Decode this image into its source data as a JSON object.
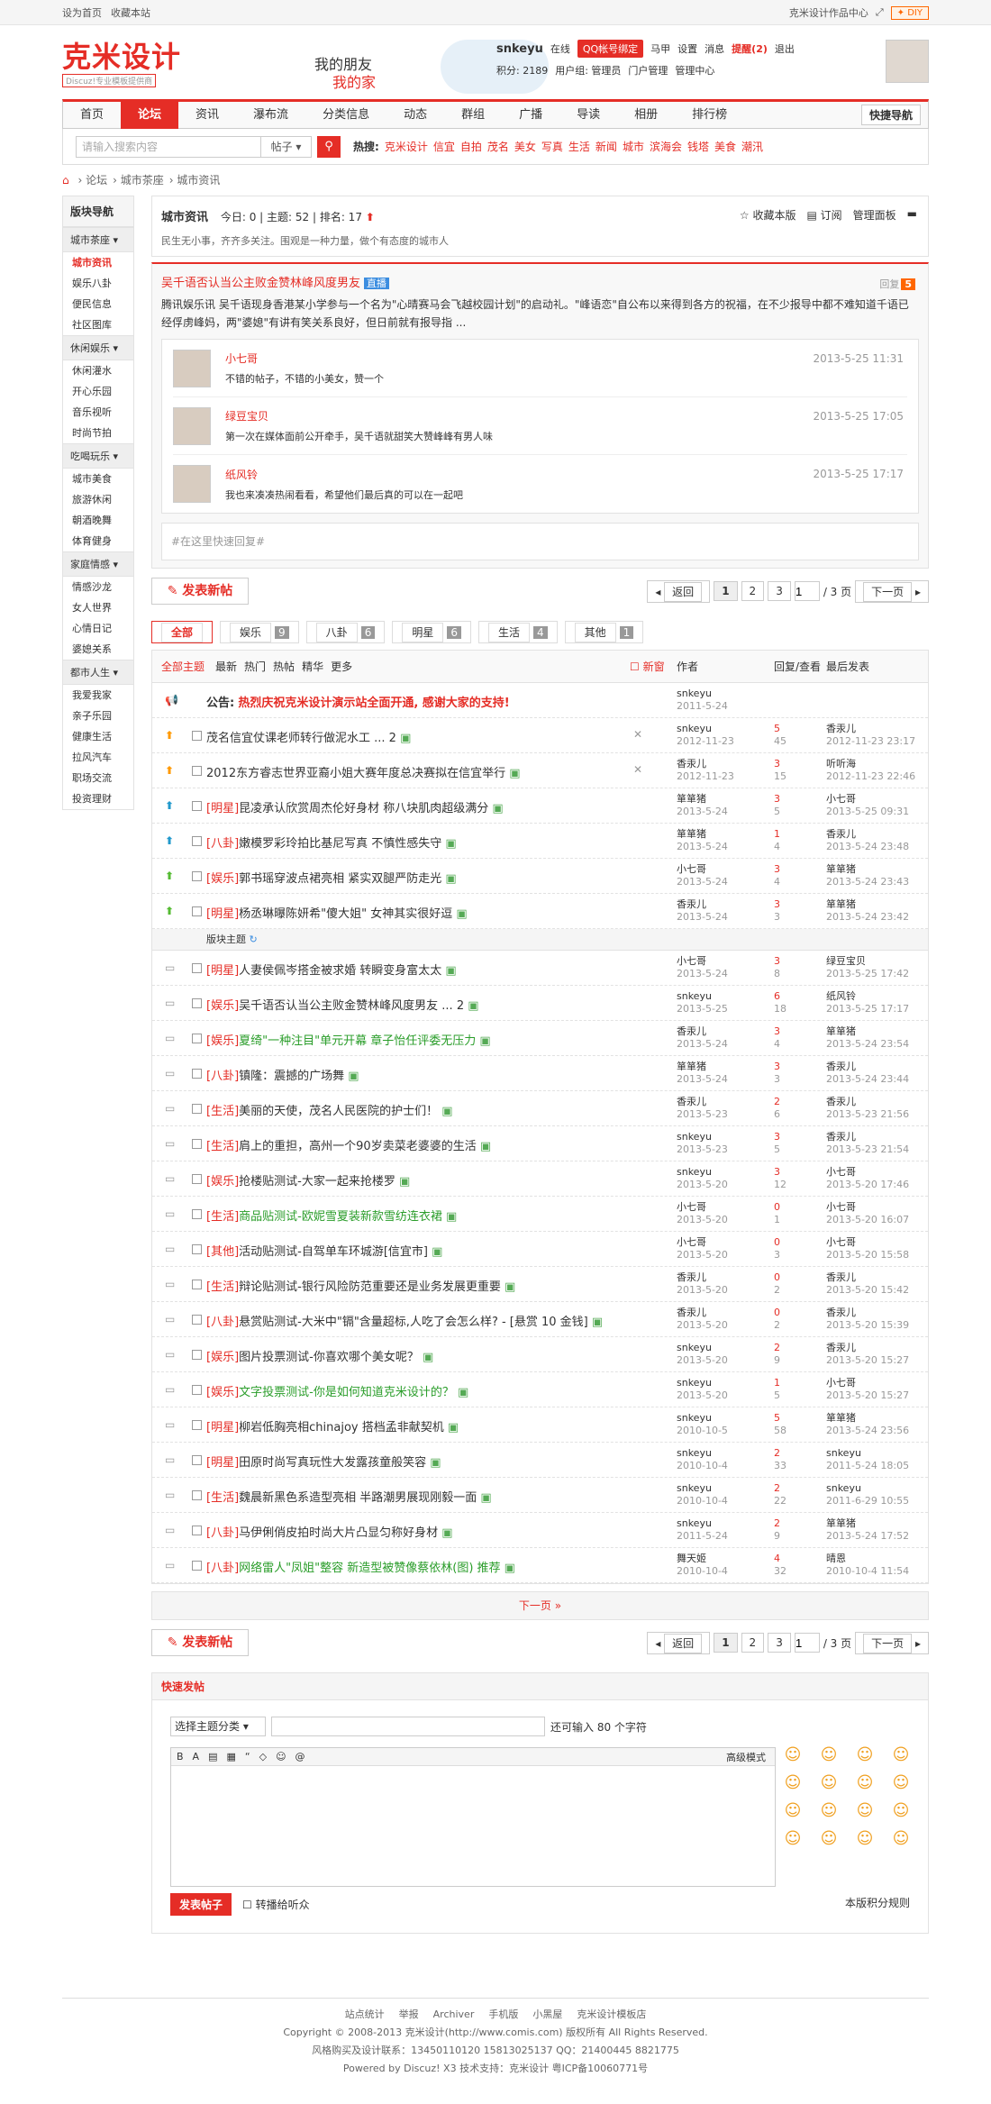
{
  "topbar": {
    "home": "设为首页",
    "fav": "收藏本站",
    "works": "克米设计作品中心",
    "diy": "DIY"
  },
  "logo": {
    "main": "克米设计",
    "sub": "Discuz!专业模板提供商"
  },
  "banner": {
    "line1": "我的朋友",
    "line2": "我的家"
  },
  "user": {
    "name": "snkeyu",
    "online": "在线",
    "qq": "QQ帐号绑定",
    "horse": "马甲",
    "settings": "设置",
    "msg": "消息",
    "alert": "提醒(2)",
    "logout": "退出",
    "points": "积分: 2189",
    "group": "用户组: 管理员",
    "portal": "门户管理",
    "admin": "管理中心"
  },
  "nav": {
    "items": [
      "首页",
      "论坛",
      "资讯",
      "瀑布流",
      "分类信息",
      "动态",
      "群组",
      "广播",
      "导读",
      "相册",
      "排行榜"
    ],
    "quick": "快捷导航"
  },
  "search": {
    "placeholder": "请输入搜索内容",
    "type": "帖子",
    "hot_label": "热搜:",
    "hot": [
      "克米设计",
      "信宜",
      "自拍",
      "茂名",
      "美女",
      "写真",
      "生活",
      "新闻",
      "城市",
      "滨海会",
      "钱塔",
      "美食",
      "潮汛"
    ]
  },
  "crumb": [
    "论坛",
    "城市茶座",
    "城市资讯"
  ],
  "side": {
    "title": "版块导航",
    "groups": [
      {
        "name": "城市茶座",
        "items": [
          "城市资讯",
          "娱乐八卦",
          "便民信息",
          "社区图库"
        ]
      },
      {
        "name": "休闲娱乐",
        "items": [
          "休闲灌水",
          "开心乐园",
          "音乐视听",
          "时尚节拍"
        ]
      },
      {
        "name": "吃喝玩乐",
        "items": [
          "城市美食",
          "旅游休闲",
          "朝酒晚舞",
          "体育健身"
        ]
      },
      {
        "name": "家庭情感",
        "items": [
          "情感沙龙",
          "女人世界",
          "心情日记",
          "婆媳关系"
        ]
      },
      {
        "name": "都市人生",
        "items": [
          "我爱我家",
          "亲子乐园",
          "健康生活",
          "拉风汽车",
          "职场交流",
          "投资理财"
        ]
      }
    ]
  },
  "forum": {
    "title": "城市资讯",
    "today": "今日: 0",
    "threads": "主题: 52",
    "rank": "排名: 17",
    "desc": "民生无小事，齐齐多关注。围观是一种力量，做个有态度的城市人",
    "fav": "收藏本版",
    "rss": "订阅",
    "manage": "管理面板"
  },
  "featured": {
    "title": "吴千语否认当公主败金赞林峰风度男友",
    "badge": "直播",
    "reply": "回复",
    "count": "5",
    "summary": "腾讯娱乐讯 吴千语现身香港某小学参与一个名为\"心晴赛马会飞越校园计划\"的启动礼。\"峰语恋\"自公布以来得到各方的祝福，在不少报导中都不难知道千语已经俘虏峰妈，两\"婆媳\"有讲有笑关系良好，但日前就有报导指 ...",
    "replies": [
      {
        "user": "小七哥",
        "msg": "不错的帖子，不错的小美女，赞一个",
        "date": "2013-5-25 11:31"
      },
      {
        "user": "绿豆宝贝",
        "msg": "第一次在媒体面前公开牵手，吴千语就甜笑大赞峰峰有男人味",
        "date": "2013-5-25 17:05"
      },
      {
        "user": "纸风铃",
        "msg": "我也来凑凑热闹看看，希望他们最后真的可以在一起吧",
        "date": "2013-5-25 17:17"
      }
    ],
    "quick": "#在这里快速回复#"
  },
  "pager": {
    "newpost": "发表新帖",
    "back": "返回",
    "pages": [
      "1",
      "2",
      "3"
    ],
    "total": "/ 3 页",
    "next": "下一页"
  },
  "tabs": [
    {
      "label": "全部",
      "n": ""
    },
    {
      "label": "娱乐",
      "n": "9"
    },
    {
      "label": "八卦",
      "n": "6"
    },
    {
      "label": "明星",
      "n": "6"
    },
    {
      "label": "生活",
      "n": "4"
    },
    {
      "label": "其他",
      "n": "1"
    }
  ],
  "thead": {
    "all": "全部主题",
    "newest": "最新",
    "hot": "热门",
    "heat": "热帖",
    "digest": "精华",
    "more": "更多",
    "new": "新窗",
    "author": "作者",
    "rv": "回复/查看",
    "last": "最后发表"
  },
  "announce": {
    "label": "公告:",
    "title": "热烈庆祝克米设计演示站全面开通, 感谢大家的支持!",
    "author": "snkeyu",
    "date": "2011-5-24"
  },
  "sticky": [
    {
      "cat": "",
      "title": "茂名信宜仗课老师转行做泥水工",
      "extra": "... 2",
      "au": "snkeyu",
      "ad": "2012-11-23",
      "r": "5",
      "v": "45",
      "lu": "香汞儿",
      "ld": "2012-11-23 23:17"
    },
    {
      "cat": "",
      "title": "2012东方睿志世界亚裔小姐大赛年度总决赛拟在信宜举行",
      "extra": "",
      "au": "香汞儿",
      "ad": "2012-11-23",
      "r": "3",
      "v": "15",
      "lu": "听听海",
      "ld": "2012-11-23 22:46"
    },
    {
      "cat": "[明星]",
      "title": "昆凌承认欣赏周杰伦好身材 称八块肌肉超级满分",
      "extra": "",
      "au": "箪箪猪",
      "ad": "2013-5-24",
      "r": "3",
      "v": "5",
      "lu": "小七哥",
      "ld": "2013-5-25 09:31"
    },
    {
      "cat": "[八卦]",
      "title": "嫩模罗彩玲拍比基尼写真 不慎性感失守",
      "extra": "",
      "au": "箪箪猪",
      "ad": "2013-5-24",
      "r": "1",
      "v": "4",
      "lu": "香汞儿",
      "ld": "2013-5-24 23:48"
    },
    {
      "cat": "[娱乐]",
      "title": "郭书瑶穿波点裙亮相 紧实双腿严防走光",
      "extra": "",
      "au": "小七哥",
      "ad": "2013-5-24",
      "r": "3",
      "v": "4",
      "lu": "箪箪猪",
      "ld": "2013-5-24 23:43"
    },
    {
      "cat": "[明星]",
      "title": "杨丞琳曝陈妍希\"傻大姐\" 女神其实很好逗",
      "extra": "",
      "au": "香汞儿",
      "ad": "2013-5-24",
      "r": "3",
      "v": "3",
      "lu": "箪箪猪",
      "ld": "2013-5-24 23:42"
    }
  ],
  "sep": "版块主题",
  "normal": [
    {
      "cat": "[明星]",
      "title": "人妻侯佩岑搭金被求婚 转瞬变身富太太",
      "au": "小七哥",
      "ad": "2013-5-24",
      "r": "3",
      "v": "8",
      "lu": "绿豆宝贝",
      "ld": "2013-5-25 17:42"
    },
    {
      "cat": "[娱乐]",
      "title": "吴千语否认当公主败金赞林峰风度男友 ... 2",
      "au": "snkeyu",
      "ad": "2013-5-25",
      "r": "6",
      "v": "18",
      "lu": "纸风铃",
      "ld": "2013-5-25 17:17"
    },
    {
      "cat": "[娱乐]",
      "title": "夏绮\"一种注目\"单元开幕 章子怡任评委无压力",
      "au": "香汞儿",
      "ad": "2013-5-24",
      "r": "3",
      "v": "4",
      "lu": "箪箪猪",
      "ld": "2013-5-24 23:54"
    },
    {
      "cat": "[八卦]",
      "title": "镇隆：震撼的广场舞",
      "au": "箪箪猪",
      "ad": "2013-5-24",
      "r": "3",
      "v": "3",
      "lu": "香汞儿",
      "ld": "2013-5-24 23:44"
    },
    {
      "cat": "[生活]",
      "title": "美丽的天使，茂名人民医院的护士们！",
      "au": "香汞儿",
      "ad": "2013-5-23",
      "r": "2",
      "v": "6",
      "lu": "香汞儿",
      "ld": "2013-5-23 21:56"
    },
    {
      "cat": "[生活]",
      "title": "肩上的重担，高州一个90岁卖菜老婆婆的生活",
      "au": "snkeyu",
      "ad": "2013-5-23",
      "r": "3",
      "v": "5",
      "lu": "香汞儿",
      "ld": "2013-5-23 21:54"
    },
    {
      "cat": "[娱乐]",
      "title": "抢楼贴测试-大家一起来抢楼罗",
      "au": "snkeyu",
      "ad": "2013-5-20",
      "r": "3",
      "v": "12",
      "lu": "小七哥",
      "ld": "2013-5-20 17:46"
    },
    {
      "cat": "[生活]",
      "title": "商品贴测试-欧妮雪夏装新款雪纺连衣裙",
      "au": "小七哥",
      "ad": "2013-5-20",
      "r": "0",
      "v": "1",
      "lu": "小七哥",
      "ld": "2013-5-20 16:07"
    },
    {
      "cat": "[其他]",
      "title": "活动贴测试-自驾单车环城游[信宜市]",
      "au": "小七哥",
      "ad": "2013-5-20",
      "r": "0",
      "v": "3",
      "lu": "小七哥",
      "ld": "2013-5-20 15:58"
    },
    {
      "cat": "[生活]",
      "title": "辩论贴测试-银行风险防范重要还是业务发展更重要",
      "au": "香汞儿",
      "ad": "2013-5-20",
      "r": "0",
      "v": "2",
      "lu": "香汞儿",
      "ld": "2013-5-20 15:42"
    },
    {
      "cat": "[八卦]",
      "title": "悬赏贴测试-大米中\"镉\"含量超标,人吃了会怎么样? - [悬赏 10 金钱]",
      "au": "香汞儿",
      "ad": "2013-5-20",
      "r": "0",
      "v": "2",
      "lu": "香汞儿",
      "ld": "2013-5-20 15:39"
    },
    {
      "cat": "[娱乐]",
      "title": "图片投票测试-你喜欢哪个美女呢？",
      "au": "snkeyu",
      "ad": "2013-5-20",
      "r": "2",
      "v": "9",
      "lu": "香汞儿",
      "ld": "2013-5-20 15:27"
    },
    {
      "cat": "[娱乐]",
      "title": "文字投票测试-你是如何知道克米设计的？",
      "au": "snkeyu",
      "ad": "2013-5-20",
      "r": "1",
      "v": "5",
      "lu": "小七哥",
      "ld": "2013-5-20 15:27"
    },
    {
      "cat": "[明星]",
      "title": "柳岩低胸亮相chinajoy 搭档孟非献契机",
      "au": "snkeyu",
      "ad": "2010-10-5",
      "r": "5",
      "v": "58",
      "lu": "箪箪猪",
      "ld": "2013-5-24 23:56"
    },
    {
      "cat": "[明星]",
      "title": "田原时尚写真玩性大发露孩童般笑容",
      "au": "snkeyu",
      "ad": "2010-10-4",
      "r": "2",
      "v": "33",
      "lu": "snkeyu",
      "ld": "2011-5-24 18:05"
    },
    {
      "cat": "[生活]",
      "title": "魏晨新黑色系造型亮相 半路潮男展现刚毅一面",
      "au": "snkeyu",
      "ad": "2010-10-4",
      "r": "2",
      "v": "22",
      "lu": "snkeyu",
      "ld": "2011-6-29 10:55"
    },
    {
      "cat": "[八卦]",
      "title": "马伊俐俏皮拍时尚大片凸显匀称好身材",
      "au": "snkeyu",
      "ad": "2011-5-24",
      "r": "2",
      "v": "9",
      "lu": "箪箪猪",
      "ld": "2013-5-24 17:52"
    },
    {
      "cat": "[八卦]",
      "title": "网络雷人\"凤姐\"整容 新造型被赞像蔡依林(图) 推荐",
      "au": "舞天姬",
      "ad": "2010-10-4",
      "r": "4",
      "v": "32",
      "lu": "晴恩",
      "ld": "2010-10-4 11:54"
    }
  ],
  "morebar": "下一页 »",
  "quickpost": {
    "title": "快速发帖",
    "cat": "选择主题分类",
    "limit": "还可输入 80 个字符",
    "adv": "高级模式",
    "tools": [
      "B",
      "A",
      "▤",
      "▦",
      "“",
      "◇",
      "☺",
      "@"
    ],
    "submit": "发表帖子",
    "tw": "转播给听众",
    "rule": "本版积分规则"
  },
  "footer": {
    "links": [
      "站点统计",
      "举报",
      "Archiver",
      "手机版",
      "小黑屋",
      "克米设计模板店"
    ],
    "copy": "Copyright © 2008-2013 克米设计(http://www.comis.com) 版权所有 All Rights Reserved.",
    "contact": "风格购买及设计联系：13450110120 15813025137 QQ：21400445 8821775",
    "power": "Powered by Discuz! X3  技术支持：克米设计  粤ICP备10060771号"
  }
}
